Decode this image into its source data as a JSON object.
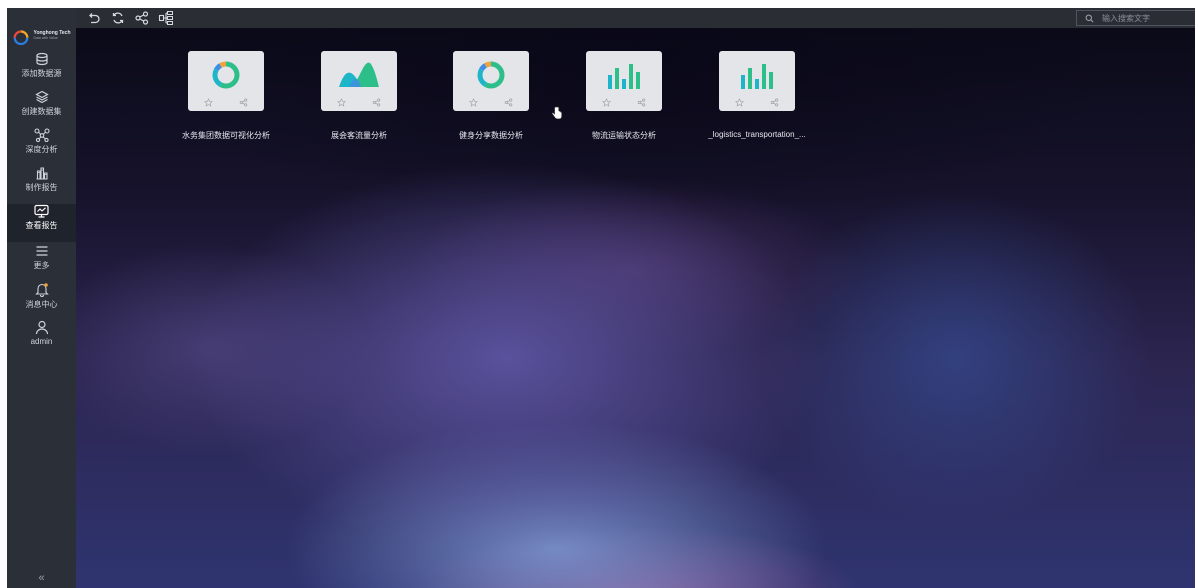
{
  "brand": {
    "name": "Yonghong Tech",
    "sub": "Data with Value",
    "colors": [
      "#e94b3c",
      "#f5a623",
      "#2a7de1"
    ]
  },
  "sidebar": {
    "items": [
      {
        "label": "添加数据源",
        "icon": "database-icon"
      },
      {
        "label": "创建数据集",
        "icon": "layers-icon"
      },
      {
        "label": "深度分析",
        "icon": "network-icon"
      },
      {
        "label": "制作报告",
        "icon": "report-make-icon"
      },
      {
        "label": "查看报告",
        "icon": "monitor-icon",
        "active": true
      },
      {
        "label": "更多",
        "icon": "menu-icon"
      },
      {
        "label": "消息中心",
        "icon": "bell-icon"
      },
      {
        "label": "admin",
        "icon": "user-icon"
      }
    ],
    "collapse_glyph": "«"
  },
  "toolbar": {
    "buttons": [
      "undo-icon",
      "refresh-icon",
      "share-icon",
      "tree-icon"
    ],
    "search_placeholder": "输入搜索文字"
  },
  "reports": [
    {
      "title": "水务集团数据可视化分析",
      "chart": "donut"
    },
    {
      "title": "展会客流量分析",
      "chart": "area"
    },
    {
      "title": "健身分享数据分析",
      "chart": "donut"
    },
    {
      "title": "物流运输状态分析",
      "chart": "bar"
    },
    {
      "title": "_logistics_transportation_...",
      "chart": "bar"
    }
  ],
  "colors": {
    "accent_green": "#2dbf8a",
    "accent_teal": "#1fb5c8",
    "accent_orange": "#f0a23c",
    "accent_blue": "#3e8ee6",
    "sidebar_bg": "#2b2f38"
  }
}
